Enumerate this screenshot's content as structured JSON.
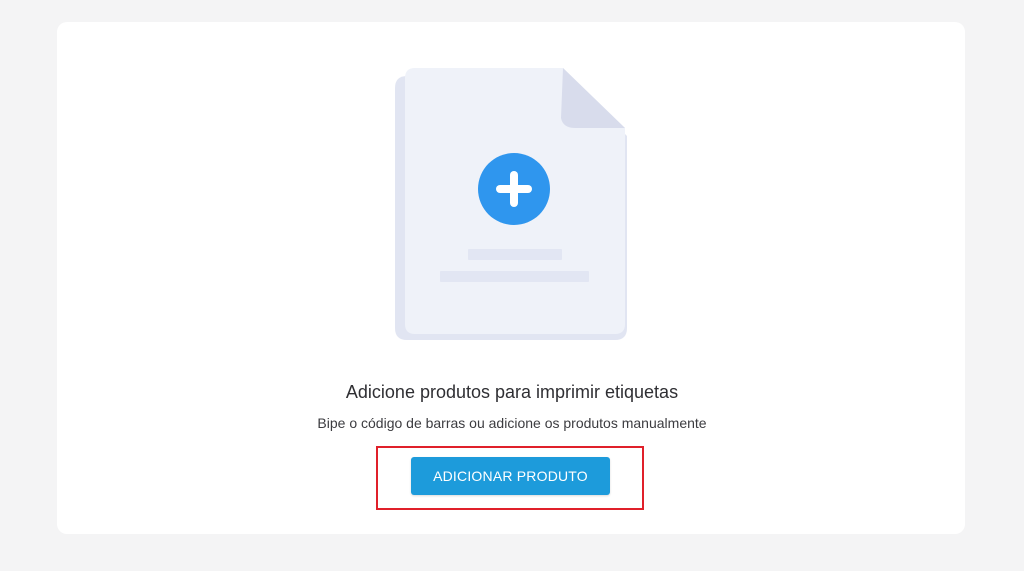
{
  "empty_state": {
    "title": "Adicione produtos para imprimir etiquetas",
    "subtitle": "Bipe o código de barras ou adicione os produtos manualmente",
    "button_label": "ADICIONAR PRODUTO",
    "illustration_icon": "document-add-icon"
  },
  "colors": {
    "page_background": "#f4f4f5",
    "card_background": "#ffffff",
    "accent_blue": "#1d9bdb",
    "plus_circle_blue": "#2f96ee",
    "highlight_red": "#e0202a"
  }
}
